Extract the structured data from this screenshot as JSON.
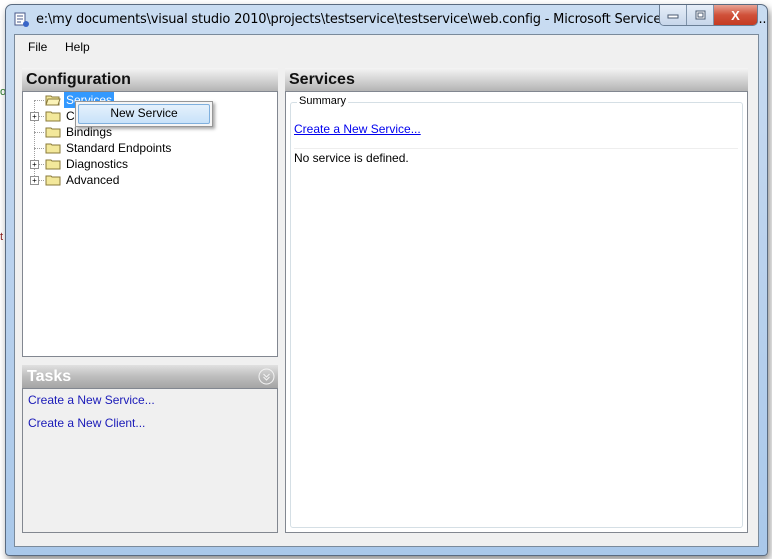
{
  "window": {
    "title": "e:\\my documents\\visual studio 2010\\projects\\testservice\\testservice\\web.config - Microsoft Service Configuration ...",
    "minimize_label": "minimize",
    "maximize_label": "maximize",
    "close_glyph": "X"
  },
  "menubar": {
    "items": [
      {
        "label": "File"
      },
      {
        "label": "Help"
      }
    ]
  },
  "configuration": {
    "header": "Configuration",
    "tree": [
      {
        "label": "Services",
        "expandable": false,
        "selected": true
      },
      {
        "label": "Client",
        "expandable": true,
        "selected": false
      },
      {
        "label": "Bindings",
        "expandable": false,
        "selected": false
      },
      {
        "label": "Standard Endpoints",
        "expandable": false,
        "selected": false
      },
      {
        "label": "Diagnostics",
        "expandable": true,
        "selected": false
      },
      {
        "label": "Advanced",
        "expandable": true,
        "selected": false
      }
    ],
    "tree_visible_labels": [
      "Services",
      "Cl",
      "Bindings",
      "Standard Endpoints",
      "Diagnostics",
      "Advanced"
    ],
    "context_menu": {
      "items": [
        {
          "label": "New Service"
        }
      ]
    }
  },
  "tasks": {
    "header": "Tasks",
    "links": [
      {
        "label": "Create a New Service..."
      },
      {
        "label": "Create a New Client..."
      }
    ]
  },
  "services": {
    "header": "Services",
    "summary_label": "Summary",
    "create_link": "Create a New Service...",
    "empty_message": "No service is defined."
  },
  "colors": {
    "link": "#0000ee",
    "task_link": "#1a1ab8",
    "selection": "#3399ff",
    "close_button": "#c43a22"
  }
}
